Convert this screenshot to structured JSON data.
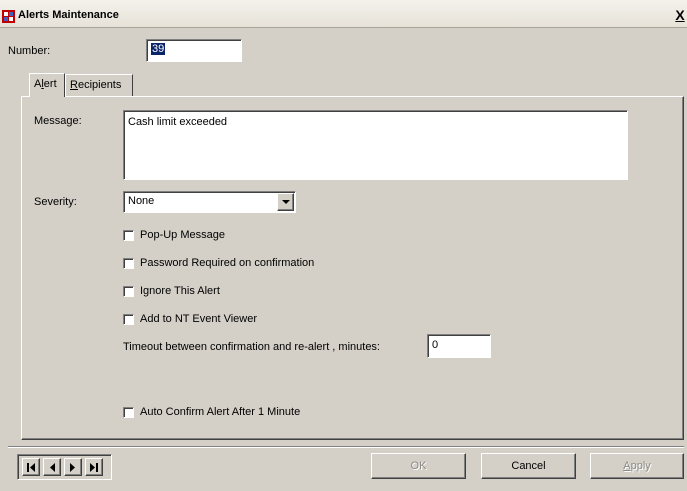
{
  "window": {
    "title": "Alerts Maintenance",
    "close_label": "X"
  },
  "number": {
    "label": "Number:",
    "value": "39"
  },
  "tabs": [
    {
      "label_prefix": "A",
      "label_u": "l",
      "label_rest": "ert"
    },
    {
      "label_prefix": "",
      "label_u": "R",
      "label_rest": "ecipients"
    }
  ],
  "alert": {
    "message_label": "Message:",
    "message_value": "Cash limit exceeded",
    "severity_label": "Severity:",
    "severity_value": "None",
    "options": [
      {
        "label": "Pop-Up Message",
        "checked": false
      },
      {
        "label": "Password Required on confirmation",
        "checked": false
      },
      {
        "label": "Ignore This Alert",
        "checked": false
      },
      {
        "label": "Add to NT Event Viewer",
        "checked": false
      }
    ],
    "timeout_label": "Timeout between confirmation and re-alert , minutes:",
    "timeout_value": "0",
    "auto_confirm": {
      "label": "Auto Confirm Alert After 1 Minute",
      "checked": false
    }
  },
  "footer": {
    "nav": {
      "first": "first-record-icon",
      "prev": "previous-record-icon",
      "next": "next-record-icon",
      "last": "last-record-icon"
    },
    "ok_label": "OK",
    "cancel_label": "Cancel",
    "apply_prefix": "",
    "apply_u": "A",
    "apply_rest": "pply"
  },
  "colors": {
    "face": "#d4d0c8",
    "selection": "#0a246a",
    "disabled_text": "#8c8a85"
  }
}
